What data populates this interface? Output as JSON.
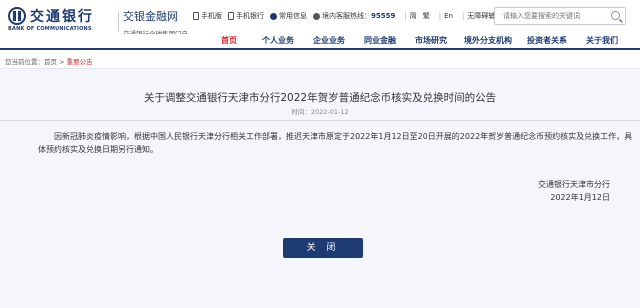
{
  "brand": {
    "logo_cn": "交通银行",
    "logo_en": "BANK OF COMMUNICATIONS",
    "portal_title": "交银金融网",
    "portal_subtitle": "交通银行全球集团门户"
  },
  "toplinks": {
    "mobile_site": "手机版",
    "mobile_bank": "手机银行",
    "faq": "常用信息",
    "hotline_label": "境内客服热线：",
    "hotline_number": "95559",
    "lang_simplified": "简",
    "lang_traditional": "繁",
    "lang_en": "En",
    "accessibility": "无障碍辅助浏览"
  },
  "search": {
    "placeholder": "请输入您要搜索的关键词"
  },
  "nav": {
    "items": [
      "首页",
      "个人业务",
      "企业业务",
      "同业金融",
      "市场研究",
      "境外分支机构",
      "投资者关系",
      "关于我们"
    ]
  },
  "breadcrumb": {
    "prefix": "您当前位置：首页 > ",
    "current": "重要公告"
  },
  "notice": {
    "title": "关于调整交通银行天津市分行2022年贺岁普通纪念币核实及兑换时间的公告",
    "date": "时间：2022-01-12",
    "body": "因新冠肺炎疫情影响，根据中国人民银行天津分行相关工作部署，推迟天津市原定于2022年1月12日至20日开展的2022年贺岁普通纪念币预约核实及兑换工作，具体预约核实及兑换日期另行通知。",
    "signer": "交通银行天津市分行",
    "sign_date": "2022年1月12日",
    "close_label": "关 闭"
  },
  "colors": {
    "brand_blue": "#1e3a73",
    "accent_red": "#d7282f",
    "panel_bg": "#f4f6fb"
  }
}
